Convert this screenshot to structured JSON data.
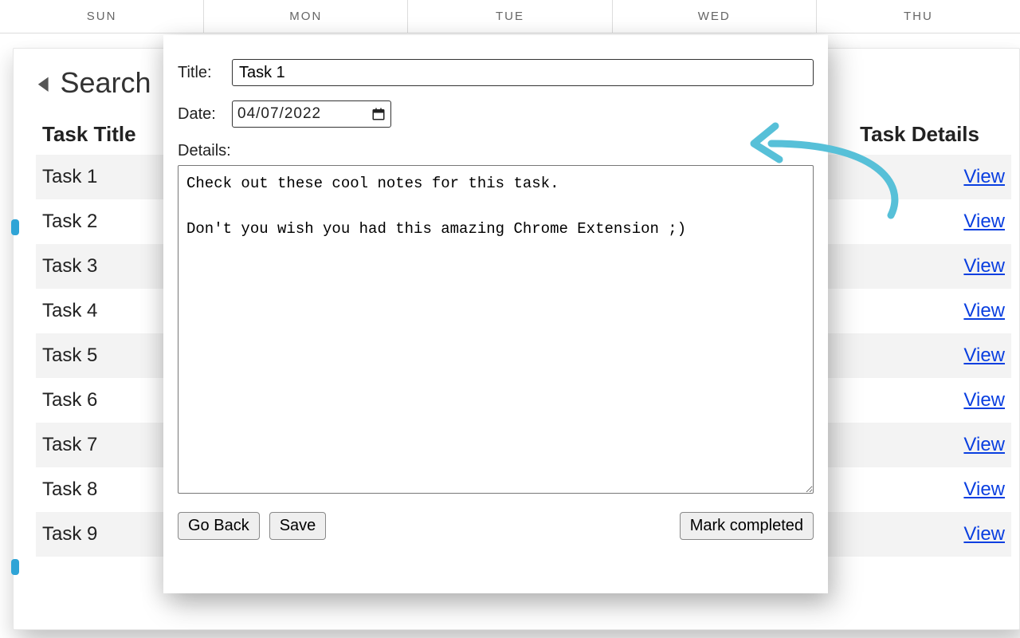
{
  "calendar": {
    "days": [
      "SUN",
      "MON",
      "TUE",
      "WED",
      "THU"
    ]
  },
  "panel": {
    "search_label": "Search",
    "title_header": "Task Title",
    "details_header": "Task Details",
    "view_label": "View",
    "tasks": [
      {
        "title": "Task 1"
      },
      {
        "title": "Task 2"
      },
      {
        "title": "Task 3"
      },
      {
        "title": "Task 4"
      },
      {
        "title": "Task 5"
      },
      {
        "title": "Task 6"
      },
      {
        "title": "Task 7"
      },
      {
        "title": "Task 8"
      },
      {
        "title": "Task 9"
      }
    ]
  },
  "modal": {
    "title_label": "Title:",
    "title_value": "Task 1",
    "date_label": "Date:",
    "date_value": "04/07/2022",
    "details_label": "Details:",
    "details_value": "Check out these cool notes for this task.\n\nDon't you wish you had this amazing Chrome Extension ;)",
    "go_back": "Go Back",
    "save": "Save",
    "mark_completed": "Mark completed"
  },
  "colors": {
    "arrow": "#57c0d8"
  }
}
